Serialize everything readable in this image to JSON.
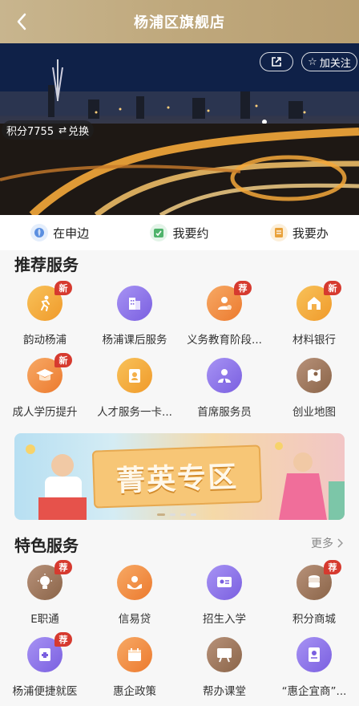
{
  "header": {
    "title": "杨浦区旗舰店"
  },
  "banner": {
    "follow_label": "加关注",
    "points_label": "积分7755",
    "redeem_label": "兑换"
  },
  "quicknav": [
    {
      "label": "在申边",
      "icon": "location-icon",
      "color": "#5b8fe0"
    },
    {
      "label": "我要约",
      "icon": "appointment-icon",
      "color": "#4fb36b"
    },
    {
      "label": "我要办",
      "icon": "document-icon",
      "color": "#e9a23b"
    }
  ],
  "recommended": {
    "title": "推荐服务",
    "items": [
      {
        "label": "韵动杨浦",
        "badge": "新",
        "icon": "runner-icon",
        "color": "#f3a53a"
      },
      {
        "label": "杨浦课后服务",
        "badge": "",
        "icon": "building-icon",
        "color": "#8a6ee6"
      },
      {
        "label": "义务教育阶段...",
        "badge": "荐",
        "icon": "teacher-icon",
        "color": "#f08a3a"
      },
      {
        "label": "材料银行",
        "badge": "新",
        "icon": "house-icon",
        "color": "#f3a53a"
      },
      {
        "label": "成人学历提升",
        "badge": "新",
        "icon": "graduation-cap-icon",
        "color": "#f08a3a"
      },
      {
        "label": "人才服务一卡...",
        "badge": "",
        "icon": "id-card-icon",
        "color": "#f3a53a"
      },
      {
        "label": "首席服务员",
        "badge": "",
        "icon": "staff-icon",
        "color": "#8a6ee6"
      },
      {
        "label": "创业地图",
        "badge": "",
        "icon": "map-icon",
        "color": "#9a7458"
      }
    ]
  },
  "promo": {
    "text": "菁英专区"
  },
  "featured": {
    "title": "特色服务",
    "more_label": "更多",
    "items": [
      {
        "label": "E职通",
        "badge": "荐",
        "icon": "lightbulb-icon",
        "color": "#9a7458"
      },
      {
        "label": "信易贷",
        "badge": "",
        "icon": "money-hands-icon",
        "color": "#f08a3a"
      },
      {
        "label": "招生入学",
        "badge": "",
        "icon": "enrollment-icon",
        "color": "#8a6ee6"
      },
      {
        "label": "积分商城",
        "badge": "荐",
        "icon": "coins-icon",
        "color": "#9a7458"
      },
      {
        "label": "杨浦便捷就医",
        "badge": "荐",
        "icon": "medical-icon",
        "color": "#8a6ee6"
      },
      {
        "label": "惠企政策",
        "badge": "",
        "icon": "calendar-icon",
        "color": "#f08a3a"
      },
      {
        "label": "帮办课堂",
        "badge": "",
        "icon": "classroom-icon",
        "color": "#9a7458"
      },
      {
        "label": "“惠企宜商”...",
        "badge": "",
        "icon": "book-icon",
        "color": "#8a6ee6"
      }
    ]
  }
}
